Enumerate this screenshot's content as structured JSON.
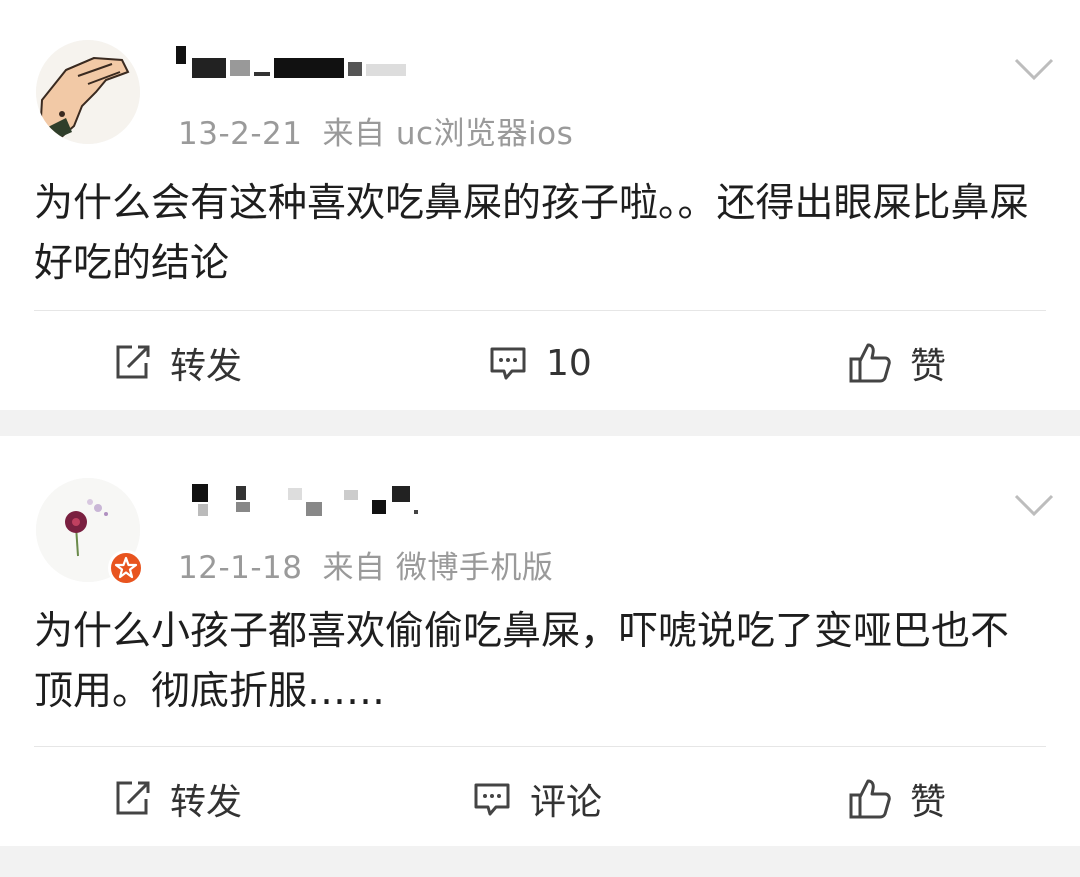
{
  "posts": [
    {
      "date": "13-2-21",
      "source": "来自 uc浏览器ios",
      "text": "为什么会有这种喜欢吃鼻屎的孩子啦。。还得出眼屎比鼻屎好吃的结论",
      "actions": {
        "repost": "转发",
        "comment": "10",
        "like": "赞"
      },
      "verified": false
    },
    {
      "date": "12-1-18",
      "source": "来自 微博手机版",
      "text": "为什么小孩子都喜欢偷偷吃鼻屎，吓唬说吃了变哑巴也不顶用。彻底折服……",
      "actions": {
        "repost": "转发",
        "comment": "评论",
        "like": "赞"
      },
      "verified": true
    }
  ],
  "icons": {
    "repost": "repost-icon",
    "comment": "comment-icon",
    "like": "thumbs-up-icon",
    "more": "chevron-down-icon",
    "verified": "verified-badge-icon"
  },
  "colors": {
    "background": "#f2f2f2",
    "card": "#ffffff",
    "meta_text": "#9a9a9a",
    "verified_badge": "#e8541f"
  }
}
